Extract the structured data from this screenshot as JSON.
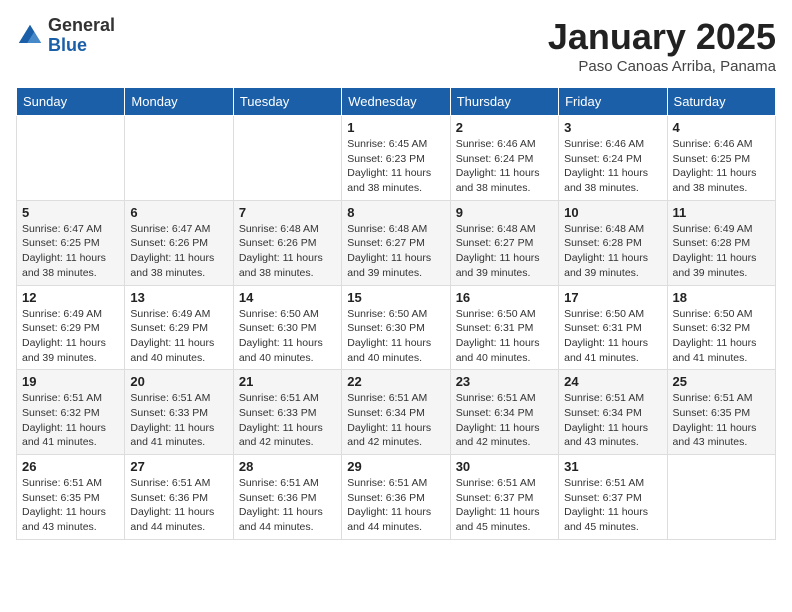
{
  "logo": {
    "general": "General",
    "blue": "Blue"
  },
  "header": {
    "month": "January 2025",
    "location": "Paso Canoas Arriba, Panama"
  },
  "weekdays": [
    "Sunday",
    "Monday",
    "Tuesday",
    "Wednesday",
    "Thursday",
    "Friday",
    "Saturday"
  ],
  "weeks": [
    [
      {
        "day": "",
        "sunrise": "",
        "sunset": "",
        "daylight": ""
      },
      {
        "day": "",
        "sunrise": "",
        "sunset": "",
        "daylight": ""
      },
      {
        "day": "",
        "sunrise": "",
        "sunset": "",
        "daylight": ""
      },
      {
        "day": "1",
        "sunrise": "Sunrise: 6:45 AM",
        "sunset": "Sunset: 6:23 PM",
        "daylight": "Daylight: 11 hours and 38 minutes."
      },
      {
        "day": "2",
        "sunrise": "Sunrise: 6:46 AM",
        "sunset": "Sunset: 6:24 PM",
        "daylight": "Daylight: 11 hours and 38 minutes."
      },
      {
        "day": "3",
        "sunrise": "Sunrise: 6:46 AM",
        "sunset": "Sunset: 6:24 PM",
        "daylight": "Daylight: 11 hours and 38 minutes."
      },
      {
        "day": "4",
        "sunrise": "Sunrise: 6:46 AM",
        "sunset": "Sunset: 6:25 PM",
        "daylight": "Daylight: 11 hours and 38 minutes."
      }
    ],
    [
      {
        "day": "5",
        "sunrise": "Sunrise: 6:47 AM",
        "sunset": "Sunset: 6:25 PM",
        "daylight": "Daylight: 11 hours and 38 minutes."
      },
      {
        "day": "6",
        "sunrise": "Sunrise: 6:47 AM",
        "sunset": "Sunset: 6:26 PM",
        "daylight": "Daylight: 11 hours and 38 minutes."
      },
      {
        "day": "7",
        "sunrise": "Sunrise: 6:48 AM",
        "sunset": "Sunset: 6:26 PM",
        "daylight": "Daylight: 11 hours and 38 minutes."
      },
      {
        "day": "8",
        "sunrise": "Sunrise: 6:48 AM",
        "sunset": "Sunset: 6:27 PM",
        "daylight": "Daylight: 11 hours and 39 minutes."
      },
      {
        "day": "9",
        "sunrise": "Sunrise: 6:48 AM",
        "sunset": "Sunset: 6:27 PM",
        "daylight": "Daylight: 11 hours and 39 minutes."
      },
      {
        "day": "10",
        "sunrise": "Sunrise: 6:48 AM",
        "sunset": "Sunset: 6:28 PM",
        "daylight": "Daylight: 11 hours and 39 minutes."
      },
      {
        "day": "11",
        "sunrise": "Sunrise: 6:49 AM",
        "sunset": "Sunset: 6:28 PM",
        "daylight": "Daylight: 11 hours and 39 minutes."
      }
    ],
    [
      {
        "day": "12",
        "sunrise": "Sunrise: 6:49 AM",
        "sunset": "Sunset: 6:29 PM",
        "daylight": "Daylight: 11 hours and 39 minutes."
      },
      {
        "day": "13",
        "sunrise": "Sunrise: 6:49 AM",
        "sunset": "Sunset: 6:29 PM",
        "daylight": "Daylight: 11 hours and 40 minutes."
      },
      {
        "day": "14",
        "sunrise": "Sunrise: 6:50 AM",
        "sunset": "Sunset: 6:30 PM",
        "daylight": "Daylight: 11 hours and 40 minutes."
      },
      {
        "day": "15",
        "sunrise": "Sunrise: 6:50 AM",
        "sunset": "Sunset: 6:30 PM",
        "daylight": "Daylight: 11 hours and 40 minutes."
      },
      {
        "day": "16",
        "sunrise": "Sunrise: 6:50 AM",
        "sunset": "Sunset: 6:31 PM",
        "daylight": "Daylight: 11 hours and 40 minutes."
      },
      {
        "day": "17",
        "sunrise": "Sunrise: 6:50 AM",
        "sunset": "Sunset: 6:31 PM",
        "daylight": "Daylight: 11 hours and 41 minutes."
      },
      {
        "day": "18",
        "sunrise": "Sunrise: 6:50 AM",
        "sunset": "Sunset: 6:32 PM",
        "daylight": "Daylight: 11 hours and 41 minutes."
      }
    ],
    [
      {
        "day": "19",
        "sunrise": "Sunrise: 6:51 AM",
        "sunset": "Sunset: 6:32 PM",
        "daylight": "Daylight: 11 hours and 41 minutes."
      },
      {
        "day": "20",
        "sunrise": "Sunrise: 6:51 AM",
        "sunset": "Sunset: 6:33 PM",
        "daylight": "Daylight: 11 hours and 41 minutes."
      },
      {
        "day": "21",
        "sunrise": "Sunrise: 6:51 AM",
        "sunset": "Sunset: 6:33 PM",
        "daylight": "Daylight: 11 hours and 42 minutes."
      },
      {
        "day": "22",
        "sunrise": "Sunrise: 6:51 AM",
        "sunset": "Sunset: 6:34 PM",
        "daylight": "Daylight: 11 hours and 42 minutes."
      },
      {
        "day": "23",
        "sunrise": "Sunrise: 6:51 AM",
        "sunset": "Sunset: 6:34 PM",
        "daylight": "Daylight: 11 hours and 42 minutes."
      },
      {
        "day": "24",
        "sunrise": "Sunrise: 6:51 AM",
        "sunset": "Sunset: 6:34 PM",
        "daylight": "Daylight: 11 hours and 43 minutes."
      },
      {
        "day": "25",
        "sunrise": "Sunrise: 6:51 AM",
        "sunset": "Sunset: 6:35 PM",
        "daylight": "Daylight: 11 hours and 43 minutes."
      }
    ],
    [
      {
        "day": "26",
        "sunrise": "Sunrise: 6:51 AM",
        "sunset": "Sunset: 6:35 PM",
        "daylight": "Daylight: 11 hours and 43 minutes."
      },
      {
        "day": "27",
        "sunrise": "Sunrise: 6:51 AM",
        "sunset": "Sunset: 6:36 PM",
        "daylight": "Daylight: 11 hours and 44 minutes."
      },
      {
        "day": "28",
        "sunrise": "Sunrise: 6:51 AM",
        "sunset": "Sunset: 6:36 PM",
        "daylight": "Daylight: 11 hours and 44 minutes."
      },
      {
        "day": "29",
        "sunrise": "Sunrise: 6:51 AM",
        "sunset": "Sunset: 6:36 PM",
        "daylight": "Daylight: 11 hours and 44 minutes."
      },
      {
        "day": "30",
        "sunrise": "Sunrise: 6:51 AM",
        "sunset": "Sunset: 6:37 PM",
        "daylight": "Daylight: 11 hours and 45 minutes."
      },
      {
        "day": "31",
        "sunrise": "Sunrise: 6:51 AM",
        "sunset": "Sunset: 6:37 PM",
        "daylight": "Daylight: 11 hours and 45 minutes."
      },
      {
        "day": "",
        "sunrise": "",
        "sunset": "",
        "daylight": ""
      }
    ]
  ]
}
